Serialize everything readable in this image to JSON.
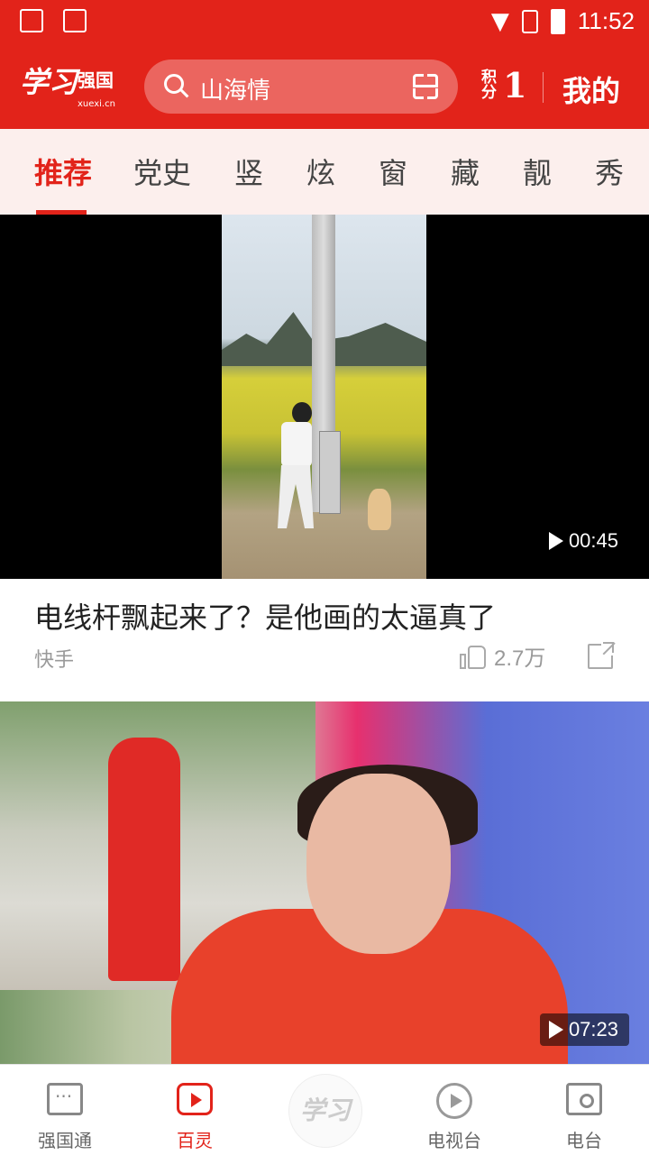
{
  "status_bar": {
    "time": "11:52"
  },
  "header": {
    "logo_text": "学习",
    "logo_suffix": "强国",
    "logo_sub": "xuexi.cn",
    "search_placeholder": "山海情",
    "points_label": "积分",
    "points_value": "1",
    "mine_label": "我的",
    "accent_color": "#e2231a"
  },
  "tabs": [
    {
      "label": "推荐"
    },
    {
      "label": "党史"
    },
    {
      "label": "竖"
    },
    {
      "label": "炫"
    },
    {
      "label": "窗"
    },
    {
      "label": "藏"
    },
    {
      "label": "靓"
    },
    {
      "label": "秀"
    }
  ],
  "active_tab": "推荐",
  "feed": [
    {
      "duration": "00:45",
      "title": "电线杆飘起来了？是他画的太逼真了",
      "source": "快手",
      "likes": "2.7万"
    },
    {
      "duration": "07:23"
    }
  ],
  "bottom_nav": [
    {
      "label": "强国通",
      "icon": "chat-icon"
    },
    {
      "label": "百灵",
      "icon": "video-play-icon"
    },
    {
      "label": "学习",
      "icon": "xuexi-logo-icon"
    },
    {
      "label": "电视台",
      "icon": "tv-play-icon"
    },
    {
      "label": "电台",
      "icon": "radio-icon"
    }
  ]
}
